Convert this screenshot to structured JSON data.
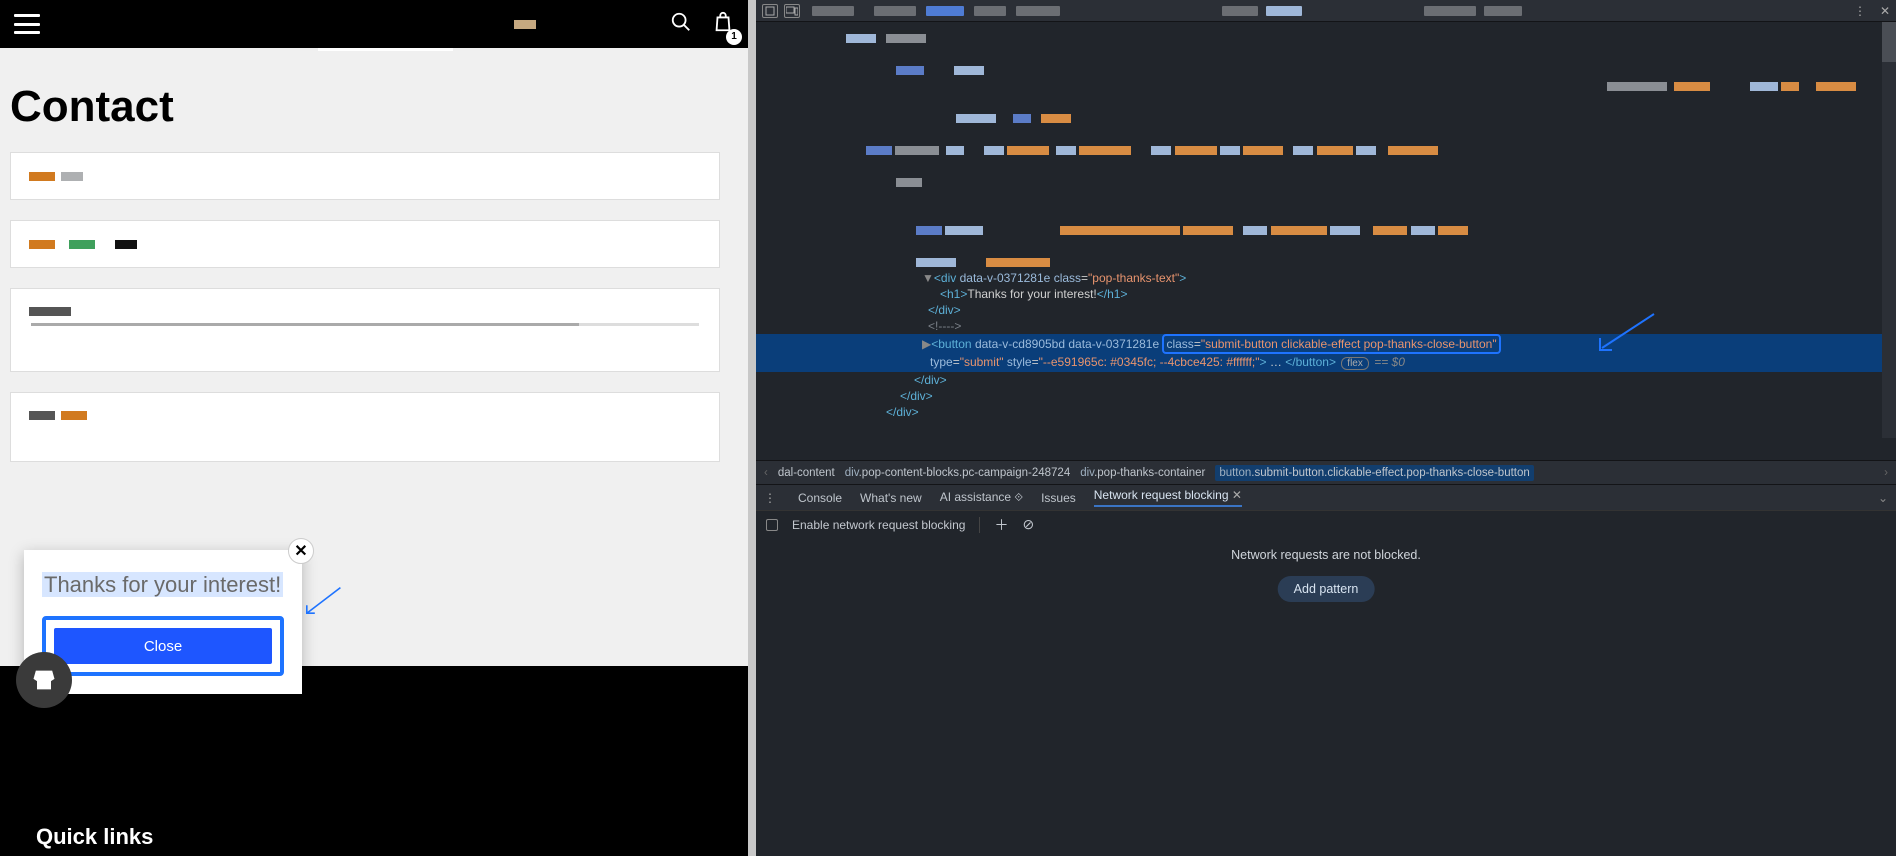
{
  "left": {
    "cart_count": "1",
    "page_title": "Contact",
    "quick_links": "Quick links"
  },
  "popup": {
    "text": "Thanks for your interest!",
    "close_label": "Close"
  },
  "devtools": {
    "code": {
      "line1_open": "<div",
      "line1_a1n": "data-v-0371281e",
      "line1_a2n": "class",
      "line1_a2v": "\"pop-thanks-text\"",
      "line1_end": ">",
      "line2_open": "<h1>",
      "line2_txt": "Thanks for your interest!",
      "line2_close": "</h1>",
      "line3": "</div>",
      "line4": "<!---->",
      "sel_open": "<button",
      "sel_a1": "data-v-cd8905bd",
      "sel_a2": "data-v-0371281e",
      "sel_cls_n": "class",
      "sel_cls_v": "\"submit-button clickable-effect pop-thanks-close-button\"",
      "sel_b_type_n": "type",
      "sel_b_type_v": "\"submit\"",
      "sel_b_style_n": "style",
      "sel_b_style_v": "\"--e591965c: #0345fc; --4cbce425: #ffffff;\"",
      "sel_end": ">",
      "sel_ell": "…",
      "sel_close": "</button>",
      "flex_badge": "flex",
      "eq0": "== $0",
      "c1": "</div>",
      "c2": "</div>",
      "c3": "</div>"
    },
    "breadcrumb": {
      "c1_cls": "dal-content",
      "c2_tag": "div",
      "c2_cls": ".pop-content-blocks.pc-campaign-248724",
      "c3_tag": "div",
      "c3_cls": ".pop-thanks-container",
      "sel_tag": "button",
      "sel_cls": ".submit-button.clickable-effect.pop-thanks-close-button"
    },
    "drawer": {
      "tabs": {
        "console": "Console",
        "whatsnew": "What's new",
        "ai": "AI assistance",
        "issues": "Issues",
        "nrb": "Network request blocking"
      },
      "enable_label": "Enable network request blocking",
      "not_blocked": "Network requests are not blocked.",
      "add_pattern": "Add pattern"
    }
  }
}
